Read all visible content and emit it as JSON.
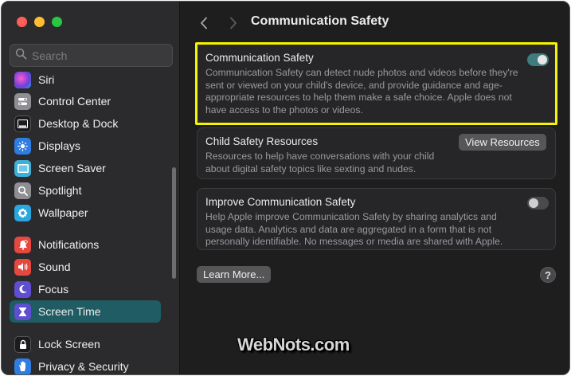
{
  "window": {
    "traffic_lights": {
      "close": "#fe5f57",
      "minimize": "#febc2e",
      "zoom": "#28c840"
    }
  },
  "sidebar": {
    "search_placeholder": "Search",
    "items": [
      {
        "label": "Siri",
        "icon": "siri-icon",
        "color": "#7b3fb6",
        "active": false
      },
      {
        "label": "Control Center",
        "icon": "control-center-icon",
        "color": "#8e8e93",
        "active": false
      },
      {
        "label": "Desktop & Dock",
        "icon": "desktop-dock-icon",
        "color": "#1c1c1e",
        "active": false
      },
      {
        "label": "Displays",
        "icon": "displays-icon",
        "color": "#2f7de1",
        "active": false
      },
      {
        "label": "Screen Saver",
        "icon": "screen-saver-icon",
        "color": "#3bb0d9",
        "active": false
      },
      {
        "label": "Spotlight",
        "icon": "spotlight-icon",
        "color": "#8e8e93",
        "active": false
      },
      {
        "label": "Wallpaper",
        "icon": "wallpaper-icon",
        "color": "#2aa6e0",
        "active": false
      },
      {
        "label": "Notifications",
        "icon": "notifications-icon",
        "color": "#e5483f",
        "active": false
      },
      {
        "label": "Sound",
        "icon": "sound-icon",
        "color": "#e5483f",
        "active": false
      },
      {
        "label": "Focus",
        "icon": "focus-icon",
        "color": "#5e4fd0",
        "active": false
      },
      {
        "label": "Screen Time",
        "icon": "screen-time-icon",
        "color": "#5e4fd0",
        "active": true
      },
      {
        "label": "Lock Screen",
        "icon": "lock-screen-icon",
        "color": "#1c1c1e",
        "active": false
      },
      {
        "label": "Privacy & Security",
        "icon": "privacy-hand-icon",
        "color": "#2f7de1",
        "active": false
      }
    ]
  },
  "main": {
    "title": "Communication Safety",
    "cards": [
      {
        "title": "Communication Safety",
        "description": "Communication Safety can detect nude photos and videos before they're sent or viewed on your child's device, and provide guidance and age-appropriate resources to help them make a safe choice. Apple does not have access to the photos or videos.",
        "toggle_on": true
      },
      {
        "title": "Child Safety Resources",
        "description": "Resources to help have conversations with your child about digital safety topics like sexting and nudes.",
        "button_label": "View Resources"
      },
      {
        "title": "Improve Communication Safety",
        "description": "Help Apple improve Communication Safety by sharing analytics and usage data. Analytics and data are aggregated in a form that is not personally identifiable. No messages or media are shared with Apple.",
        "toggle_on": false
      }
    ],
    "learn_more_label": "Learn More...",
    "help_label": "?"
  },
  "watermark": "WebNots.com",
  "colors": {
    "accent_toggle": "#3f7c80",
    "active_sidebar": "#1f5c63",
    "highlight_box": "#f5f500"
  }
}
